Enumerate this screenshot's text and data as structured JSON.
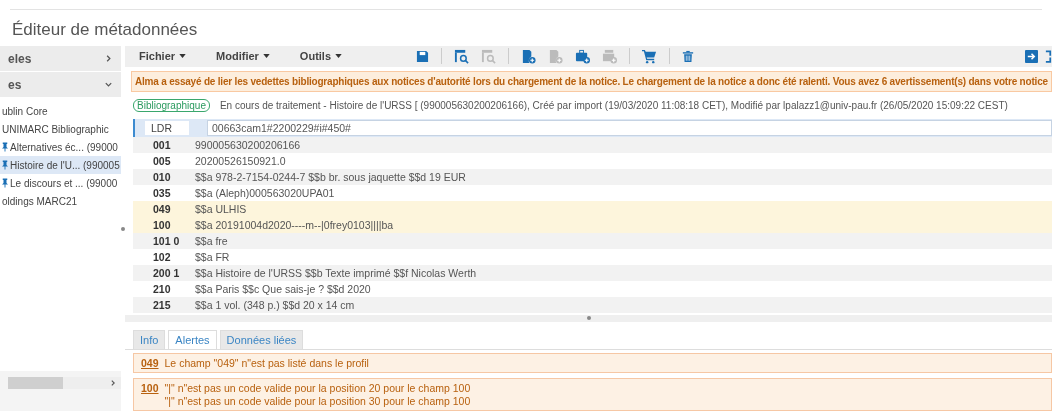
{
  "title": "Éditeur de métadonnées",
  "sidebar": {
    "sections": [
      {
        "label": "eles",
        "expanded": false
      },
      {
        "label": "es",
        "expanded": true
      }
    ],
    "items": [
      {
        "label": "ublin Core",
        "icon": false,
        "selected": false
      },
      {
        "label": "UNIMARC Bibliographic",
        "icon": false,
        "selected": false
      },
      {
        "label": "Alternatives éc... (99000",
        "icon": true,
        "selected": false
      },
      {
        "label": "Histoire de l'U... (990005",
        "icon": true,
        "selected": true
      },
      {
        "label": "Le discours et ... (99000",
        "icon": true,
        "selected": false
      },
      {
        "label": "oldings MARC21",
        "icon": false,
        "selected": false
      }
    ]
  },
  "menus": [
    "Fichier",
    "Modifier",
    "Outils"
  ],
  "toolbar": [
    {
      "kind": "save",
      "disabled": false
    },
    {
      "kind": "sep"
    },
    {
      "kind": "search",
      "disabled": false
    },
    {
      "kind": "search",
      "disabled": true
    },
    {
      "kind": "sep"
    },
    {
      "kind": "doc-add",
      "disabled": false
    },
    {
      "kind": "doc-add",
      "disabled": true
    },
    {
      "kind": "case-add",
      "disabled": false
    },
    {
      "kind": "stack-add",
      "disabled": true
    },
    {
      "kind": "sep"
    },
    {
      "kind": "cart",
      "disabled": false
    },
    {
      "kind": "sep"
    },
    {
      "kind": "trash",
      "disabled": false
    }
  ],
  "alert": "Alma a essayé de lier les vedettes bibliographiques aux notices d'autorité lors du chargement de la notice. Le chargement de la notice a donc été ralenti. Vous avez 6 avertissement(s) dans votre notice",
  "record": {
    "badge": "Bibliographique",
    "info": "En cours de traitement - Histoire de l'URSS [ (990005630200206166), Créé par import (19/03/2020 11:08:18 CET), Modifié par lpalazz1@univ-pau.fr (26/05/2020 15:09:22 CEST)"
  },
  "fields": [
    {
      "tag": "LDR",
      "value": "00663cam1#2200229#i#450#",
      "selected": true,
      "warning": false
    },
    {
      "tag": "001",
      "value": "990005630200206166",
      "selected": false,
      "warning": false
    },
    {
      "tag": "005",
      "value": "20200526150921.0",
      "selected": false,
      "warning": false
    },
    {
      "tag": "010",
      "value": "$$a 978-2-7154-0244-7 $$b br. sous jaquette $$d 19 EUR",
      "selected": false,
      "warning": false
    },
    {
      "tag": "035",
      "value": "$$a (Aleph)000563020UPA01",
      "selected": false,
      "warning": false
    },
    {
      "tag": "049",
      "value": "$$a ULHIS",
      "selected": false,
      "warning": true
    },
    {
      "tag": "100",
      "value": "$$a 20191004d2020----m--|0frey0103||||ba",
      "selected": false,
      "warning": true
    },
    {
      "tag": "101 0",
      "value": "$$a fre",
      "selected": false,
      "warning": false
    },
    {
      "tag": "102",
      "value": "$$a FR",
      "selected": false,
      "warning": false
    },
    {
      "tag": "200 1",
      "value": "$$a Histoire de l'URSS $$b Texte imprimé $$f Nicolas Werth",
      "selected": false,
      "warning": false
    },
    {
      "tag": "210",
      "value": "$$a Paris $$c Que sais-je ? $$d 2020",
      "selected": false,
      "warning": false
    },
    {
      "tag": "215",
      "value": "$$a 1 vol. (348 p.) $$d 20 x 14 cm",
      "selected": false,
      "warning": false
    }
  ],
  "tabs": [
    {
      "label": "Info",
      "selected": false
    },
    {
      "label": "Alertes",
      "selected": true
    },
    {
      "label": "Données liées",
      "selected": false
    }
  ],
  "alerts": [
    {
      "field": "049",
      "messages": [
        "Le champ \"049\" n\"est pas listé dans le profil"
      ]
    },
    {
      "field": "100",
      "messages": [
        "\"|\" n\"est pas un code valide pour la position 20 pour le champ 100",
        "\"|\" n\"est pas un code valide pour la position 30 pour le champ 100"
      ]
    }
  ]
}
